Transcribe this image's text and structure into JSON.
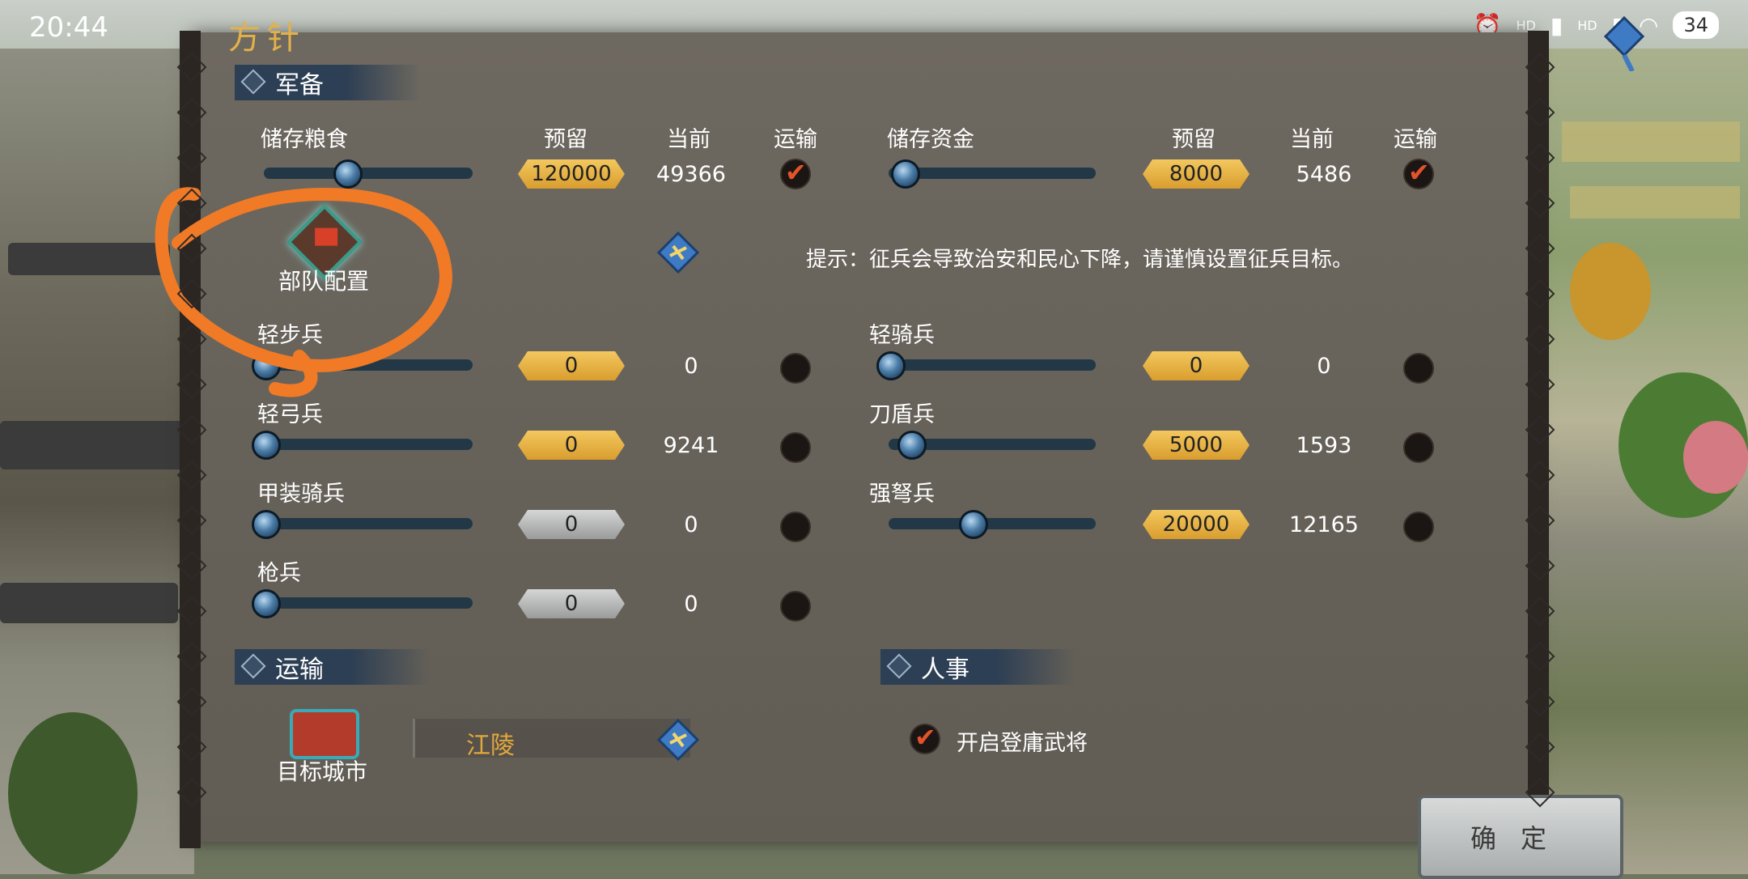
{
  "status": {
    "time": "20:44",
    "battery": "34",
    "signal1": "HD",
    "signal2": "HD"
  },
  "panel_title": "方针",
  "sections": {
    "military": "军备",
    "transport": "运输",
    "personnel": "人事"
  },
  "headers": {
    "food_storage": "储存粮食",
    "fund_storage": "储存资金",
    "reserve": "预留",
    "current": "当前",
    "transport": "运输"
  },
  "storage": {
    "food": {
      "reserve": "120000",
      "current": "49366",
      "transport_checked": true,
      "level": 0.39
    },
    "fund": {
      "reserve": "8000",
      "current": "5486",
      "transport_checked": true,
      "level": 0.07
    }
  },
  "unit_config_label": "部队配置",
  "hint": "提示：征兵会导致治安和民心下降，请谨慎设置征兵目标。",
  "units": [
    {
      "name": "轻步兵",
      "reserve": "0",
      "current": "0",
      "style": "gold",
      "level": 0.0
    },
    {
      "name": "轻骑兵",
      "reserve": "0",
      "current": "0",
      "style": "gold",
      "level": 0.0
    },
    {
      "name": "轻弓兵",
      "reserve": "0",
      "current": "9241",
      "style": "gold",
      "level": 0.0
    },
    {
      "name": "刀盾兵",
      "reserve": "5000",
      "current": "1593",
      "style": "gold",
      "level": 0.1
    },
    {
      "name": "甲装骑兵",
      "reserve": "0",
      "current": "0",
      "style": "grey",
      "level": 0.0
    },
    {
      "name": "强弩兵",
      "reserve": "20000",
      "current": "12165",
      "style": "gold",
      "level": 0.4
    },
    {
      "name": "枪兵",
      "reserve": "0",
      "current": "0",
      "style": "grey",
      "level": 0.0
    }
  ],
  "transport": {
    "target_label": "目标城市",
    "city": "江陵"
  },
  "personnel": {
    "recruit_label": "开启登庸武将",
    "recruit_checked": true
  },
  "confirm_label": "确定",
  "colors": {
    "gold": "#e8b543",
    "panel": "#66625a",
    "section": "#2d3f54",
    "annotation": "#f07a26"
  }
}
